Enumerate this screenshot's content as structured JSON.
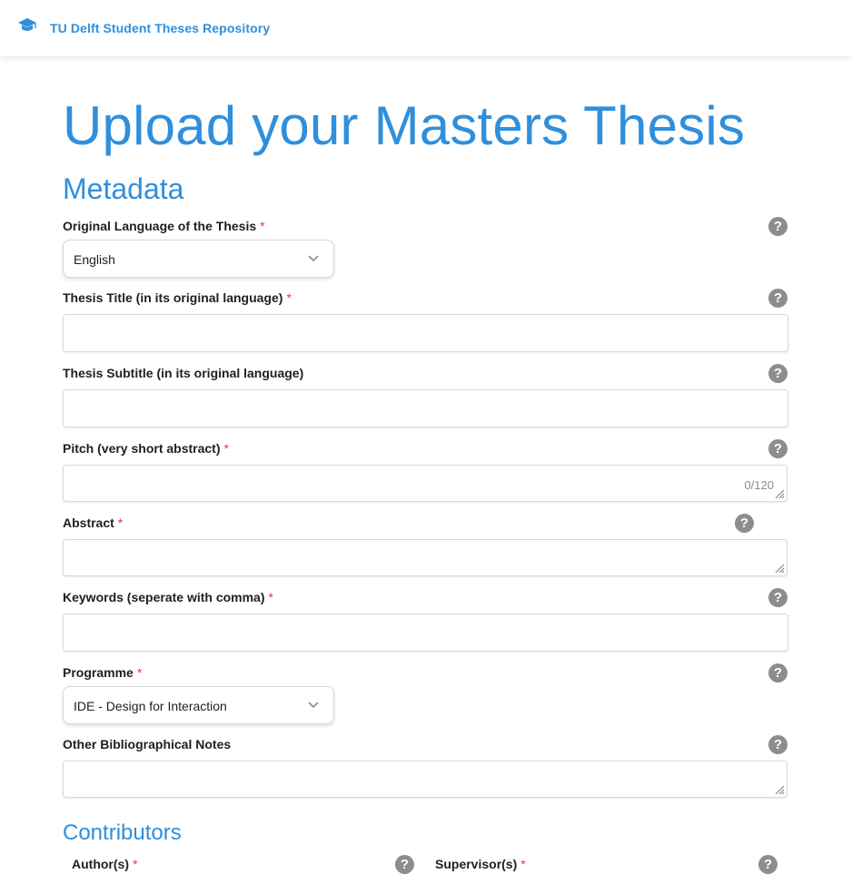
{
  "header": {
    "app_title": "TU Delft Student Theses Repository",
    "brand_icon": "graduation-cap-icon"
  },
  "colors": {
    "accent": "#2f8fdc",
    "required": "#e53935",
    "help_icon": "#8d8d8d"
  },
  "page": {
    "title": "Upload your Masters Thesis"
  },
  "metadata": {
    "section_title": "Metadata",
    "language": {
      "label": "Original Language of the Thesis",
      "required": "*",
      "value": "English"
    },
    "title": {
      "label": "Thesis Title (in its original language)",
      "required": "*",
      "value": ""
    },
    "subtitle": {
      "label": "Thesis Subtitle (in its original language)",
      "value": ""
    },
    "pitch": {
      "label": "Pitch (very short abstract)",
      "required": "*",
      "value": "",
      "counter": "0/120"
    },
    "abstract": {
      "label": "Abstract",
      "required": "*",
      "value": ""
    },
    "keywords": {
      "label": "Keywords (seperate with comma)",
      "required": "*",
      "value": ""
    },
    "programme": {
      "label": "Programme",
      "required": "*",
      "value": "IDE - Design for Interaction"
    },
    "notes": {
      "label": "Other Bibliographical Notes",
      "value": ""
    },
    "help_glyph": "?"
  },
  "contributors": {
    "section_title": "Contributors",
    "authors": {
      "label": "Author(s)",
      "required": "*"
    },
    "supervisors": {
      "label": "Supervisor(s)",
      "required": "*"
    }
  }
}
